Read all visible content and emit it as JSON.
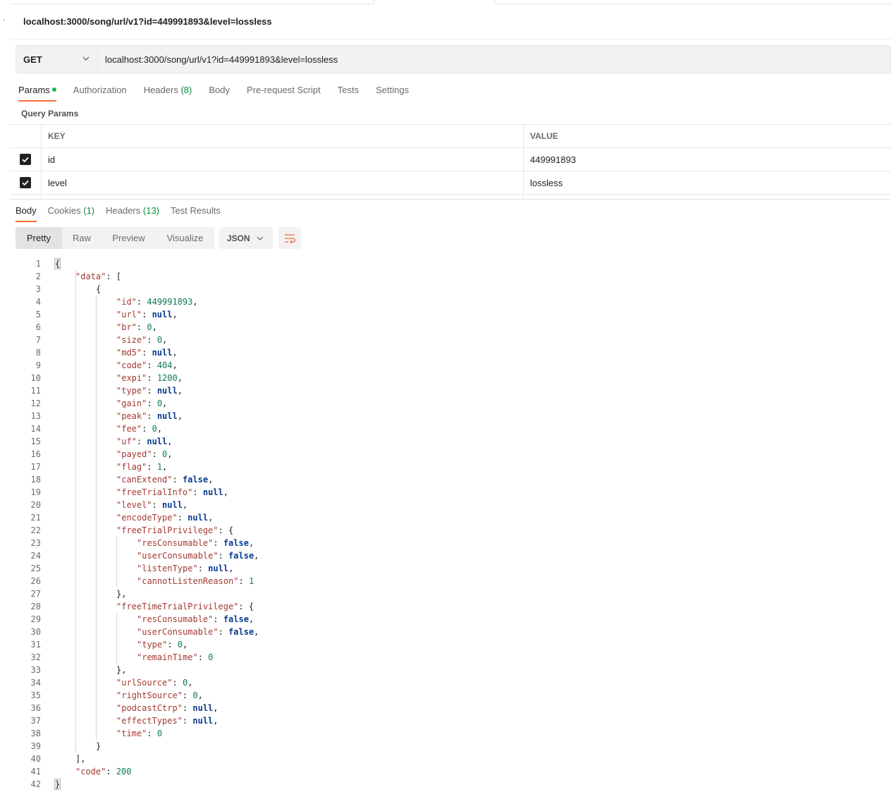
{
  "request": {
    "title": "localhost:3000/song/url/v1?id=449991893&level=lossless",
    "method": "GET",
    "url": "localhost:3000/song/url/v1?id=449991893&level=lossless"
  },
  "request_tabs": [
    {
      "label": "Params",
      "active": true,
      "dot": true
    },
    {
      "label": "Authorization"
    },
    {
      "label": "Headers",
      "count": "(8)"
    },
    {
      "label": "Body"
    },
    {
      "label": "Pre-request Script"
    },
    {
      "label": "Tests"
    },
    {
      "label": "Settings"
    }
  ],
  "query_params": {
    "label": "Query Params",
    "headers": {
      "key": "KEY",
      "value": "VALUE"
    },
    "rows": [
      {
        "checked": true,
        "key": "id",
        "value": "449991893"
      },
      {
        "checked": true,
        "key": "level",
        "value": "lossless"
      }
    ]
  },
  "response_tabs": [
    {
      "label": "Body",
      "active": true
    },
    {
      "label": "Cookies",
      "count": "(1)"
    },
    {
      "label": "Headers",
      "count": "(13)"
    },
    {
      "label": "Test Results"
    }
  ],
  "view_modes": [
    "Pretty",
    "Raw",
    "Preview",
    "Visualize"
  ],
  "active_view": "Pretty",
  "format": "JSON",
  "icons": {
    "method_dropdown": "chevron-down-icon",
    "format_dropdown": "chevron-down-icon",
    "wrap": "wrap-lines-icon",
    "checkbox": "check-icon"
  },
  "colors": {
    "accent": "#ff6c37",
    "key": "#a33a32",
    "number": "#0b7a5a",
    "keyword": "#0a3c8f",
    "count": "#0b8a3a"
  },
  "response_lines": [
    [
      [
        "p",
        "{"
      ]
    ],
    [
      [
        "k",
        "\"data\""
      ],
      [
        "p",
        ": ["
      ]
    ],
    [
      [
        "p",
        "{"
      ]
    ],
    [
      [
        "k",
        "\"id\""
      ],
      [
        "p",
        ": "
      ],
      [
        "n",
        "449991893"
      ],
      [
        "p",
        ","
      ]
    ],
    [
      [
        "k",
        "\"url\""
      ],
      [
        "p",
        ": "
      ],
      [
        "kw",
        "null"
      ],
      [
        "p",
        ","
      ]
    ],
    [
      [
        "k",
        "\"br\""
      ],
      [
        "p",
        ": "
      ],
      [
        "n",
        "0"
      ],
      [
        "p",
        ","
      ]
    ],
    [
      [
        "k",
        "\"size\""
      ],
      [
        "p",
        ": "
      ],
      [
        "n",
        "0"
      ],
      [
        "p",
        ","
      ]
    ],
    [
      [
        "k",
        "\"md5\""
      ],
      [
        "p",
        ": "
      ],
      [
        "kw",
        "null"
      ],
      [
        "p",
        ","
      ]
    ],
    [
      [
        "k",
        "\"code\""
      ],
      [
        "p",
        ": "
      ],
      [
        "n",
        "404"
      ],
      [
        "p",
        ","
      ]
    ],
    [
      [
        "k",
        "\"expi\""
      ],
      [
        "p",
        ": "
      ],
      [
        "n",
        "1200"
      ],
      [
        "p",
        ","
      ]
    ],
    [
      [
        "k",
        "\"type\""
      ],
      [
        "p",
        ": "
      ],
      [
        "kw",
        "null"
      ],
      [
        "p",
        ","
      ]
    ],
    [
      [
        "k",
        "\"gain\""
      ],
      [
        "p",
        ": "
      ],
      [
        "n",
        "0"
      ],
      [
        "p",
        ","
      ]
    ],
    [
      [
        "k",
        "\"peak\""
      ],
      [
        "p",
        ": "
      ],
      [
        "kw",
        "null"
      ],
      [
        "p",
        ","
      ]
    ],
    [
      [
        "k",
        "\"fee\""
      ],
      [
        "p",
        ": "
      ],
      [
        "n",
        "0"
      ],
      [
        "p",
        ","
      ]
    ],
    [
      [
        "k",
        "\"uf\""
      ],
      [
        "p",
        ": "
      ],
      [
        "kw",
        "null"
      ],
      [
        "p",
        ","
      ]
    ],
    [
      [
        "k",
        "\"payed\""
      ],
      [
        "p",
        ": "
      ],
      [
        "n",
        "0"
      ],
      [
        "p",
        ","
      ]
    ],
    [
      [
        "k",
        "\"flag\""
      ],
      [
        "p",
        ": "
      ],
      [
        "n",
        "1"
      ],
      [
        "p",
        ","
      ]
    ],
    [
      [
        "k",
        "\"canExtend\""
      ],
      [
        "p",
        ": "
      ],
      [
        "kw",
        "false"
      ],
      [
        "p",
        ","
      ]
    ],
    [
      [
        "k",
        "\"freeTrialInfo\""
      ],
      [
        "p",
        ": "
      ],
      [
        "kw",
        "null"
      ],
      [
        "p",
        ","
      ]
    ],
    [
      [
        "k",
        "\"level\""
      ],
      [
        "p",
        ": "
      ],
      [
        "kw",
        "null"
      ],
      [
        "p",
        ","
      ]
    ],
    [
      [
        "k",
        "\"encodeType\""
      ],
      [
        "p",
        ": "
      ],
      [
        "kw",
        "null"
      ],
      [
        "p",
        ","
      ]
    ],
    [
      [
        "k",
        "\"freeTrialPrivilege\""
      ],
      [
        "p",
        ": {"
      ]
    ],
    [
      [
        "k",
        "\"resConsumable\""
      ],
      [
        "p",
        ": "
      ],
      [
        "kw",
        "false"
      ],
      [
        "p",
        ","
      ]
    ],
    [
      [
        "k",
        "\"userConsumable\""
      ],
      [
        "p",
        ": "
      ],
      [
        "kw",
        "false"
      ],
      [
        "p",
        ","
      ]
    ],
    [
      [
        "k",
        "\"listenType\""
      ],
      [
        "p",
        ": "
      ],
      [
        "kw",
        "null"
      ],
      [
        "p",
        ","
      ]
    ],
    [
      [
        "k",
        "\"cannotListenReason\""
      ],
      [
        "p",
        ": "
      ],
      [
        "n",
        "1"
      ]
    ],
    [
      [
        "p",
        "},"
      ]
    ],
    [
      [
        "k",
        "\"freeTimeTrialPrivilege\""
      ],
      [
        "p",
        ": {"
      ]
    ],
    [
      [
        "k",
        "\"resConsumable\""
      ],
      [
        "p",
        ": "
      ],
      [
        "kw",
        "false"
      ],
      [
        "p",
        ","
      ]
    ],
    [
      [
        "k",
        "\"userConsumable\""
      ],
      [
        "p",
        ": "
      ],
      [
        "kw",
        "false"
      ],
      [
        "p",
        ","
      ]
    ],
    [
      [
        "k",
        "\"type\""
      ],
      [
        "p",
        ": "
      ],
      [
        "n",
        "0"
      ],
      [
        "p",
        ","
      ]
    ],
    [
      [
        "k",
        "\"remainTime\""
      ],
      [
        "p",
        ": "
      ],
      [
        "n",
        "0"
      ]
    ],
    [
      [
        "p",
        "},"
      ]
    ],
    [
      [
        "k",
        "\"urlSource\""
      ],
      [
        "p",
        ": "
      ],
      [
        "n",
        "0"
      ],
      [
        "p",
        ","
      ]
    ],
    [
      [
        "k",
        "\"rightSource\""
      ],
      [
        "p",
        ": "
      ],
      [
        "n",
        "0"
      ],
      [
        "p",
        ","
      ]
    ],
    [
      [
        "k",
        "\"podcastCtrp\""
      ],
      [
        "p",
        ": "
      ],
      [
        "kw",
        "null"
      ],
      [
        "p",
        ","
      ]
    ],
    [
      [
        "k",
        "\"effectTypes\""
      ],
      [
        "p",
        ": "
      ],
      [
        "kw",
        "null"
      ],
      [
        "p",
        ","
      ]
    ],
    [
      [
        "k",
        "\"time\""
      ],
      [
        "p",
        ": "
      ],
      [
        "n",
        "0"
      ]
    ],
    [
      [
        "p",
        "}"
      ]
    ],
    [
      [
        "p",
        "],"
      ]
    ],
    [
      [
        "k",
        "\"code\""
      ],
      [
        "p",
        ": "
      ],
      [
        "n",
        "200"
      ]
    ],
    [
      [
        "p",
        "}"
      ]
    ]
  ]
}
